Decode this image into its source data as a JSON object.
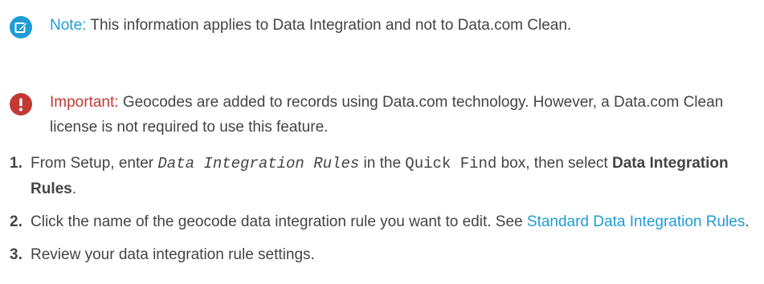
{
  "note": {
    "label": "Note:",
    "text": "This information applies to Data Integration and not to Data.com Clean.",
    "icon": "note-edit-icon",
    "color": "#1f9cd7"
  },
  "important": {
    "label": "Important:",
    "text": "Geocodes are added to records using Data.com technology. However, a Data.com Clean license is not required to use this feature.",
    "icon": "warning-icon",
    "color": "#c23934"
  },
  "steps": [
    {
      "number": "1.",
      "part1": "From Setup, enter ",
      "code_italic": "Data Integration Rules",
      "part2": " in the ",
      "code": "Quick Find",
      "part3": " box, then select ",
      "bold": "Data Integration Rules",
      "part4": "."
    },
    {
      "number": "2.",
      "part1": "Click the name of the geocode data integration rule you want to edit. See ",
      "link": "Standard Data Integration Rules",
      "part2": "."
    },
    {
      "number": "3.",
      "text": "Review your data integration rule settings."
    }
  ]
}
